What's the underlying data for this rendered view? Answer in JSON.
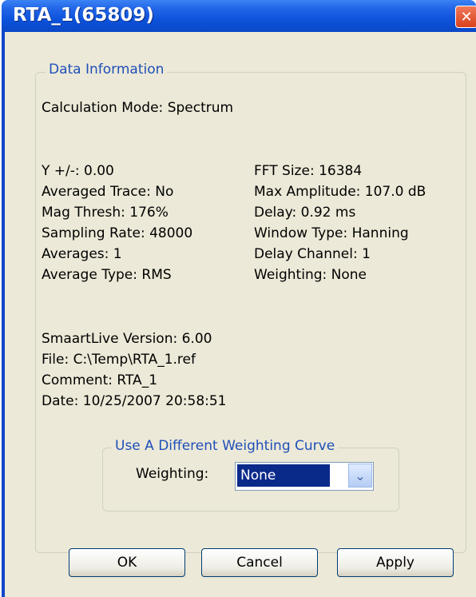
{
  "window": {
    "title": "RTA_1(65809)",
    "close_glyph": "✕"
  },
  "data_info": {
    "legend": "Data Information",
    "calc_mode": "Calculation Mode: Spectrum",
    "left": [
      "Y +/-: 0.00",
      "Averaged Trace: No",
      "Mag Thresh: 176%",
      "Sampling Rate: 48000",
      "Averages: 1",
      "Average Type: RMS"
    ],
    "right": [
      "FFT Size: 16384",
      "Max Amplitude: 107.0 dB",
      "Delay: 0.92 ms",
      "Window Type: Hanning",
      "Delay Channel: 1",
      "Weighting: None"
    ],
    "footer": [
      "SmaartLive Version: 6.00",
      "File: C:\\Temp\\RTA_1.ref",
      "Comment: RTA_1",
      "Date:  10/25/2007 20:58:51"
    ]
  },
  "weighting_group": {
    "legend": "Use A Different Weighting Curve",
    "label": "Weighting:",
    "selected": "None",
    "arrow_glyph": "⌄"
  },
  "buttons": {
    "ok": "OK",
    "cancel": "Cancel",
    "apply": "Apply"
  }
}
